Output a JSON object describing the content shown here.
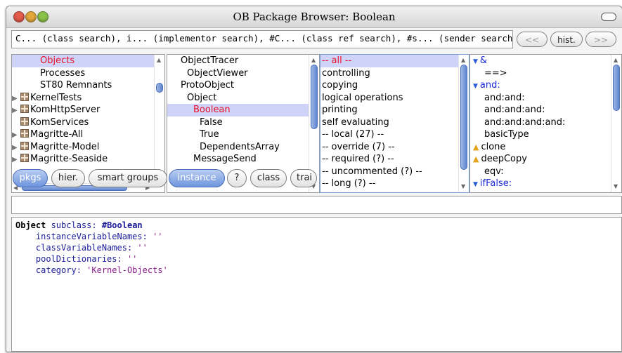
{
  "window": {
    "title": "OB Package Browser: Boolean"
  },
  "search": {
    "text": "C... (class search), i... (implementor search), #C... (class ref search), #s... (sender search)",
    "back_label": "<<",
    "hist_label": "hist.",
    "forward_label": ">>"
  },
  "packages": {
    "items": [
      {
        "label": "Objects",
        "selected": true,
        "color": "red",
        "icon": false,
        "expand": false
      },
      {
        "label": "Processes",
        "selected": false,
        "icon": false,
        "expand": false
      },
      {
        "label": "ST80 Remnants",
        "selected": false,
        "icon": false,
        "expand": false
      },
      {
        "label": "KernelTests",
        "selected": false,
        "icon": true,
        "expand": true
      },
      {
        "label": "KomHttpServer",
        "selected": false,
        "icon": true,
        "expand": true
      },
      {
        "label": "KomServices",
        "selected": false,
        "icon": true,
        "expand": false
      },
      {
        "label": "Magritte-All",
        "selected": false,
        "icon": true,
        "expand": true
      },
      {
        "label": "Magritte-Model",
        "selected": false,
        "icon": true,
        "expand": true
      },
      {
        "label": "Magritte-Seaside",
        "selected": false,
        "icon": true,
        "expand": true
      }
    ],
    "buttons": [
      "pkgs",
      "hier.",
      "smart groups"
    ]
  },
  "classes": {
    "items": [
      {
        "label": "ObjectTracer",
        "indent": 1
      },
      {
        "label": "ObjectViewer",
        "indent": 2
      },
      {
        "label": "ProtoObject",
        "indent": 1
      },
      {
        "label": "Object",
        "indent": 2
      },
      {
        "label": "Boolean",
        "indent": 3,
        "selected": true
      },
      {
        "label": "False",
        "indent": 4
      },
      {
        "label": "True",
        "indent": 4
      },
      {
        "label": "DependentsArray",
        "indent": 4
      },
      {
        "label": "MessageSend",
        "indent": 3
      }
    ],
    "buttons": [
      "instance",
      "?",
      "class",
      "trai"
    ]
  },
  "protocols": {
    "items": [
      {
        "label": "-- all --",
        "selected": true
      },
      {
        "label": "controlling"
      },
      {
        "label": "copying"
      },
      {
        "label": "logical operations"
      },
      {
        "label": "printing"
      },
      {
        "label": "self evaluating"
      },
      {
        "label": "-- local (27) --"
      },
      {
        "label": "-- override (7) --"
      },
      {
        "label": "-- required (?) --"
      },
      {
        "label": "-- uncommented (?) --"
      },
      {
        "label": "-- long (?) --"
      }
    ]
  },
  "methods": {
    "items": [
      {
        "label": "&",
        "icon": "expand",
        "color": "blue"
      },
      {
        "label": "==>",
        "icon": ""
      },
      {
        "label": "and:",
        "icon": "expand",
        "color": "blue"
      },
      {
        "label": "and:and:",
        "icon": ""
      },
      {
        "label": "and:and:and:",
        "icon": ""
      },
      {
        "label": "and:and:and:and:",
        "icon": ""
      },
      {
        "label": "basicType",
        "icon": ""
      },
      {
        "label": "clone",
        "icon": "warn"
      },
      {
        "label": "deepCopy",
        "icon": "warn"
      },
      {
        "label": "eqv:",
        "icon": ""
      },
      {
        "label": "ifFalse:",
        "icon": "expand",
        "color": "blue"
      }
    ]
  },
  "source": {
    "line1_kw": "Object",
    "line1_msg": " subclass: ",
    "line1_sym": "#Boolean",
    "line2_key": "    instanceVariableNames: ",
    "line2_val": "''",
    "line3_key": "    classVariableNames: ",
    "line3_val": "''",
    "line4_key": "    poolDictionaries: ",
    "line4_val": "''",
    "line5_key": "    category: ",
    "line5_val": "'Kernel-Objects'"
  }
}
